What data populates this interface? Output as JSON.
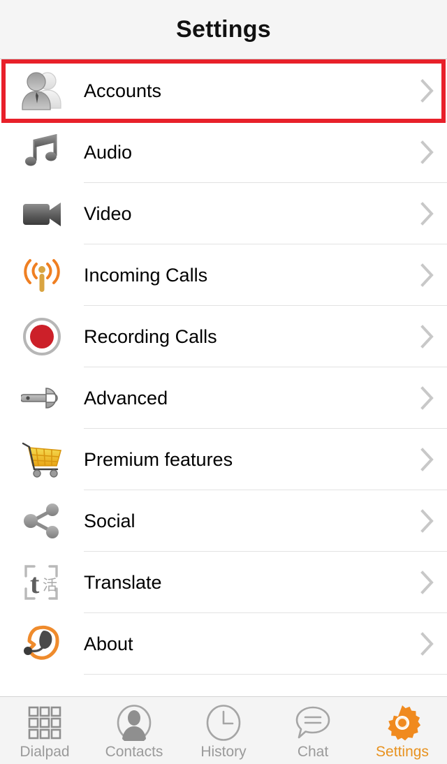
{
  "header": {
    "title": "Settings"
  },
  "highlight": {
    "color": "#e8202a",
    "target": "Accounts"
  },
  "list": {
    "rows": [
      {
        "label": "Accounts",
        "icon": "people-icon",
        "chevron": "chevron-right-icon",
        "highlighted": true
      },
      {
        "label": "Audio",
        "icon": "music-note-icon",
        "chevron": "chevron-right-icon",
        "highlighted": false
      },
      {
        "label": "Video",
        "icon": "camcorder-icon",
        "chevron": "chevron-right-icon",
        "highlighted": false
      },
      {
        "label": "Incoming Calls",
        "icon": "antenna-signal-icon",
        "chevron": "chevron-right-icon",
        "highlighted": false
      },
      {
        "label": "Recording Calls",
        "icon": "record-dot-icon",
        "chevron": "chevron-right-icon",
        "highlighted": false
      },
      {
        "label": "Advanced",
        "icon": "wrench-icon",
        "chevron": "chevron-right-icon",
        "highlighted": false
      },
      {
        "label": "Premium features",
        "icon": "shopping-cart-icon",
        "chevron": "chevron-right-icon",
        "highlighted": false
      },
      {
        "label": "Social",
        "icon": "share-nodes-icon",
        "chevron": "chevron-right-icon",
        "highlighted": false
      },
      {
        "label": "Translate",
        "icon": "translate-icon",
        "chevron": "chevron-right-icon",
        "highlighted": false
      },
      {
        "label": "About",
        "icon": "headset-bubble-icon",
        "chevron": "chevron-right-icon",
        "highlighted": false
      }
    ]
  },
  "tabbar": {
    "active": "Settings",
    "tabs": [
      {
        "label": "Dialpad",
        "icon": "dialpad-grid-icon"
      },
      {
        "label": "Contacts",
        "icon": "contact-person-icon"
      },
      {
        "label": "History",
        "icon": "clock-icon"
      },
      {
        "label": "Chat",
        "icon": "chat-bubble-icon"
      },
      {
        "label": "Settings",
        "icon": "gear-icon"
      }
    ]
  },
  "colors": {
    "accent_orange": "#e8921f",
    "highlight_red": "#e8202a",
    "record_red": "#cc2029",
    "header_bg": "#f5f5f5",
    "tabbar_bg": "#f4f4f4",
    "chevron_gray": "#c8c8c8",
    "separator": "#e2e2e2",
    "inactive_label": "#9a9a9a"
  },
  "translate_icon_glyphs": {
    "latin": "t",
    "cjk": "活"
  }
}
